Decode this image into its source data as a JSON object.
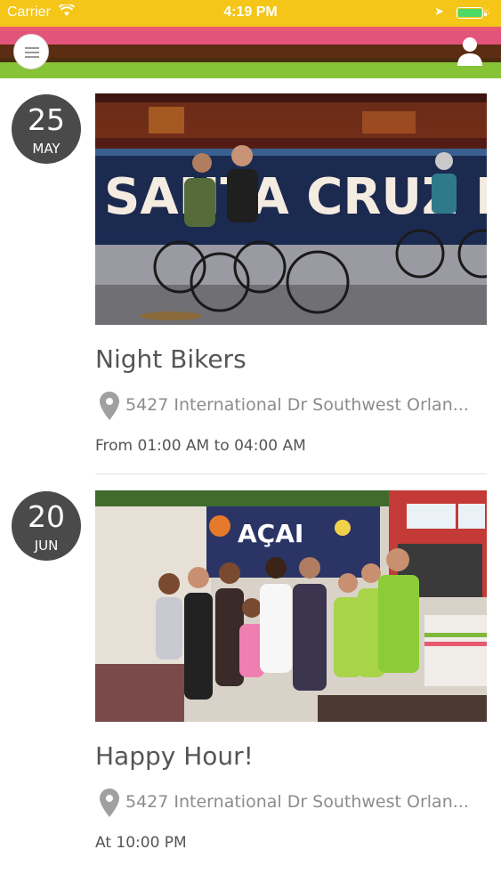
{
  "status_bar": {
    "carrier": "Carrier",
    "time": "4:19 PM",
    "battery_color": "#4cd964",
    "icons": [
      "wifi-icon",
      "location-arrow-icon",
      "battery-icon",
      "charging-bolt-icon"
    ]
  },
  "header": {
    "stripe_colors": [
      "#e85a73",
      "#e3547a",
      "#5c2d12",
      "#4a2f0f",
      "#86c336"
    ],
    "menu_icon": "hamburger-menu-icon",
    "profile_icon": "user-profile-icon"
  },
  "events": [
    {
      "day": "25",
      "month": "MAY",
      "title": "Night Bikers",
      "address": "5427 International Dr Southwest Orlan...",
      "time": "From 01:00 AM to 04:00 AM",
      "image_text": "SANTA CRUZ BEACH"
    },
    {
      "day": "20",
      "month": "JUN",
      "title": "Happy Hour!",
      "address": "5427 International Dr Southwest Orlan...",
      "time": "At  10:00 PM",
      "image_text": "AÇAI"
    }
  ]
}
